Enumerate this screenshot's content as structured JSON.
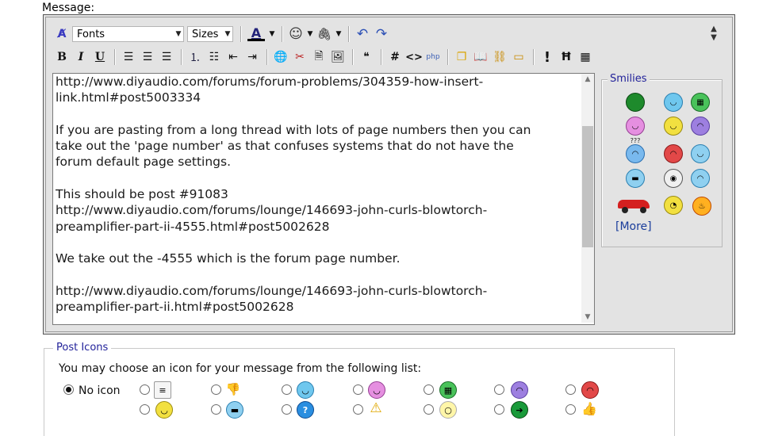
{
  "message_label": "Message:",
  "toolbar": {
    "fonts": "Fonts",
    "sizes": "Sizes",
    "font_color_letter": "A",
    "bold": "B",
    "italic": "I",
    "underline": "U",
    "hash": "#",
    "code": "<>",
    "more_toggle": "!"
  },
  "message_text": "http://www.diyaudio.com/forums/forum-problems/304359-how-insert-\nlink.html#post5003334\n\nIf you are pasting from a long thread with lots of page numbers then you can\ntake out the 'page number' as that confuses systems that do not have the\nforum default page settings.\n\nThis should be post #91083\nhttp://www.diyaudio.com/forums/lounge/146693-john-curls-blowtorch-\npreamplifier-part-ii-4555.html#post5002628\n\nWe take out the -4555 which is the forum page number.\n\nhttp://www.diyaudio.com/forums/lounge/146693-john-curls-blowtorch-\npreamplifier-part-ii.html#post5002628",
  "smilies": {
    "legend": "Smilies",
    "more": "[More]",
    "confused_mark": "???"
  },
  "post_icons": {
    "legend": "Post Icons",
    "description": "You may choose an icon for your message from the following list:",
    "no_icon": "No icon"
  },
  "colors": {
    "editor_bg": "#e3e3e3",
    "legend_blue": "#22229a",
    "link_blue": "#1a3d9b",
    "scroll_thumb": "#c2c2c2"
  }
}
